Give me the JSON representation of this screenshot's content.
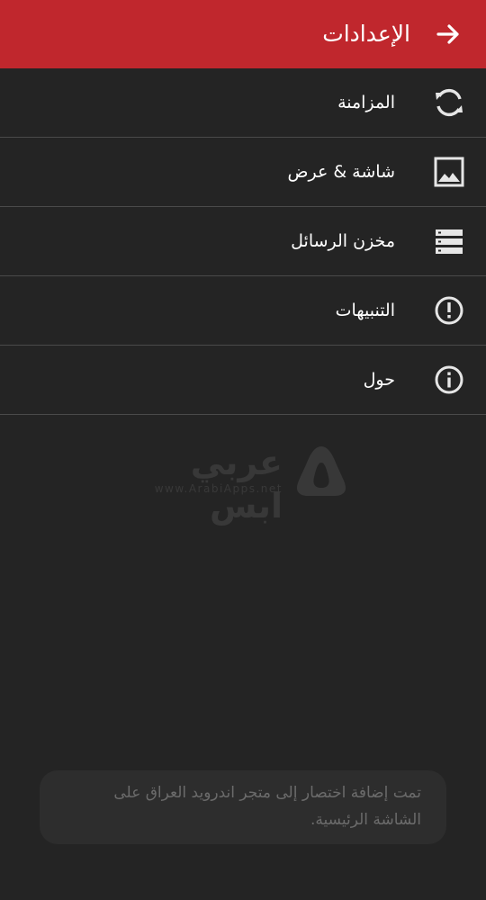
{
  "appbar": {
    "title": "الإعدادات",
    "back_icon": "arrow-right-icon",
    "color": "#c0272d"
  },
  "menu": {
    "items": [
      {
        "label": "المزامنة",
        "icon": "sync-icon"
      },
      {
        "label": "شاشة & عرض",
        "icon": "image-icon"
      },
      {
        "label": "مخزن الرسائل",
        "icon": "storage-icon"
      },
      {
        "label": "التنبيهات",
        "icon": "alert-icon"
      },
      {
        "label": "حول",
        "icon": "info-icon"
      }
    ]
  },
  "watermark": {
    "text": "عربي ابس",
    "url": "www.ArabiApps.net"
  },
  "toast": {
    "message": "تمت إضافة اختصار إلى متجر اندرويد العراق على الشاشة الرئيسية."
  }
}
